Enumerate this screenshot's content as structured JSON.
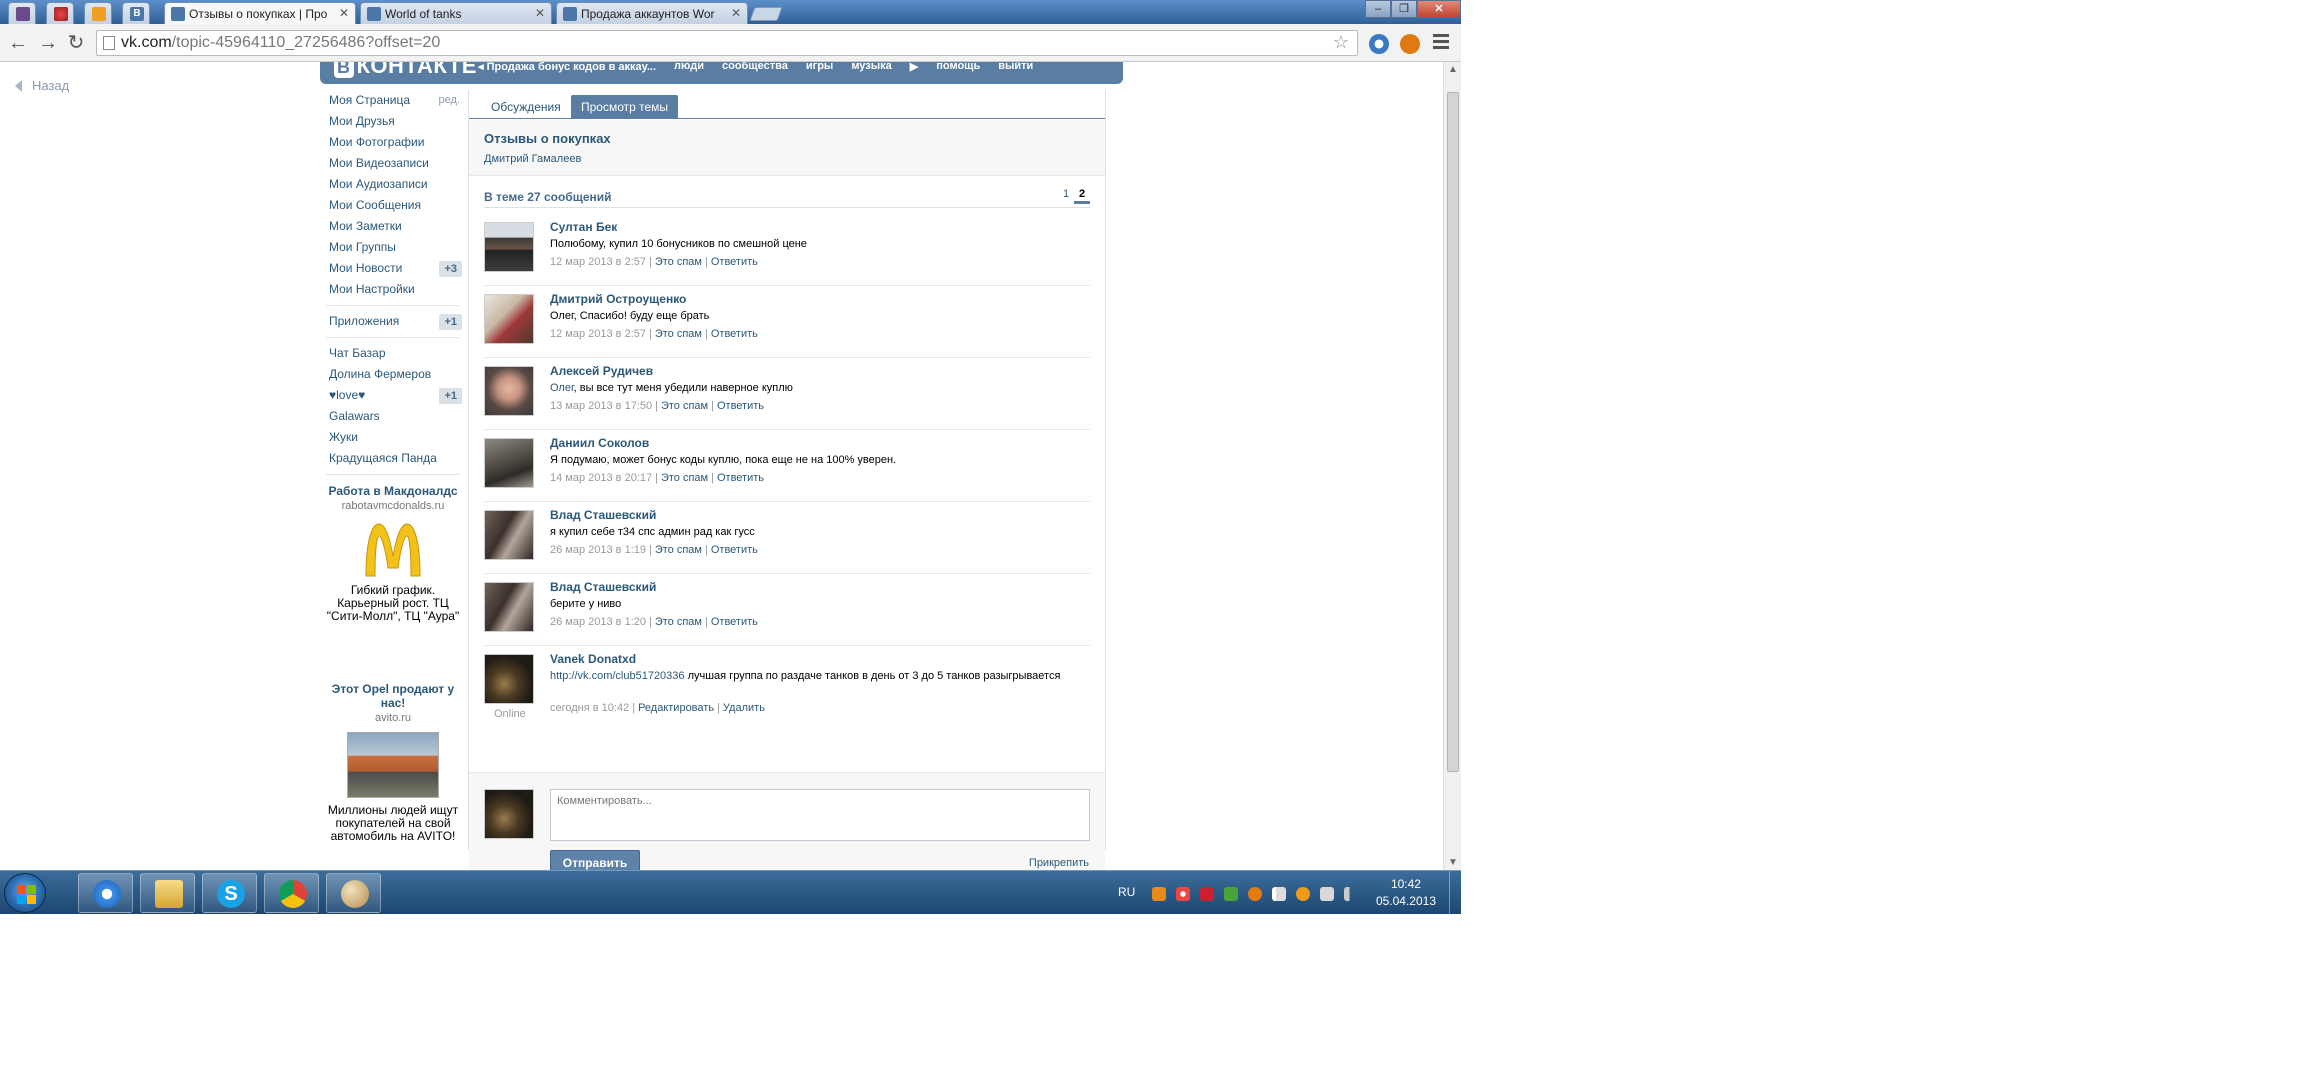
{
  "browser": {
    "tabs": [
      {
        "label": "",
        "pinned": true
      },
      {
        "label": "",
        "pinned": true
      },
      {
        "label": "",
        "pinned": true
      },
      {
        "label": "",
        "pinned": true
      },
      {
        "label": "Отзывы о покупках | Про",
        "active": true
      },
      {
        "label": "World of tanks"
      },
      {
        "label": "Продажа аккаунтов Wor"
      }
    ],
    "url_host": "vk.com",
    "url_path": "/topic-45964110_27256486?offset=20"
  },
  "page": {
    "back_label": "Назад",
    "header": {
      "logo": "ВКонтакте",
      "logo_b": "В",
      "logo_rest": "КОНТАКТЕ",
      "nav": [
        "Продажа бонус кодов в аккау...",
        "люди",
        "сообщества",
        "игры",
        "музыка",
        "помощь",
        "выйти"
      ]
    },
    "left_menu": {
      "edit_label": "ред.",
      "items": [
        {
          "label": "Моя Страница"
        },
        {
          "label": "Мои Друзья"
        },
        {
          "label": "Мои Фотографии"
        },
        {
          "label": "Мои Видеозаписи"
        },
        {
          "label": "Мои Аудиозаписи"
        },
        {
          "label": "Мои Сообщения"
        },
        {
          "label": "Мои Заметки"
        },
        {
          "label": "Мои Группы"
        },
        {
          "label": "Мои Новости",
          "badge": "+3"
        },
        {
          "label": "Мои Настройки"
        }
      ],
      "apps_label": "Приложения",
      "apps_badge": "+1",
      "apps": [
        {
          "label": "Чат Базар"
        },
        {
          "label": "Долина Фермеров"
        },
        {
          "label": "♥love♥",
          "badge": "+1"
        },
        {
          "label": "Galawars"
        },
        {
          "label": "Жуки"
        },
        {
          "label": "Крадущаяся Панда"
        }
      ]
    },
    "ads": [
      {
        "title": "Работа в Макдоналдс",
        "domain": "rabotavmcdonalds.ru",
        "text": "Гибкий график. Карьерный рост. ТЦ \"Сити-Молл\", ТЦ \"Аура\""
      },
      {
        "title": "Этот Opel продают у нас!",
        "domain": "avito.ru",
        "text": "Миллионы людей ищут покупателей на свой автомобиль на AVITO!"
      }
    ],
    "tabs": {
      "discussions": "Обсуждения",
      "view_topic": "Просмотр темы"
    },
    "topic": {
      "title": "Отзывы о покупках",
      "author": "Дмитрий Гамалеев",
      "count_label": "В теме 27 сообщений",
      "pages": [
        "1",
        "2"
      ]
    },
    "posts": [
      {
        "author": "Султан Бек",
        "text": "Полюбому, купил 10 бонусников по смешной цене",
        "date": "12 мар 2013 в 2:57",
        "spam": "Это спам",
        "reply": "Ответить"
      },
      {
        "author": "Дмитрий Остроущенко",
        "text": "Олег, Спасибо! буду еще брать",
        "date": "12 мар 2013 в 2:57",
        "spam": "Это спам",
        "reply": "Ответить"
      },
      {
        "author": "Алексей Рудичев",
        "text_link": "Олег",
        "text": ", вы все тут меня убедили наверное куплю",
        "date": "13 мар 2013 в 17:50",
        "spam": "Это спам",
        "reply": "Ответить"
      },
      {
        "author": "Даниил Соколов",
        "text": "Я подумаю, может бонус коды куплю, пока еще не на 100% уверен.",
        "date": "14 мар 2013 в 20:17",
        "spam": "Это спам",
        "reply": "Ответить"
      },
      {
        "author": "Влад Сташевский",
        "text": "я купил себе т34 спс админ рад как гусс",
        "date": "26 мар 2013 в 1:19",
        "spam": "Это спам",
        "reply": "Ответить"
      },
      {
        "author": "Влад Сташевский",
        "text": "берите у ниво",
        "date": "26 мар 2013 в 1:20",
        "spam": "Это спам",
        "reply": "Ответить"
      },
      {
        "author": "Vanek Donatxd",
        "text_link": "http://vk.com/club51720336",
        "text": " лучшая группа по раздаче танков в день от 3 до 5 танков разыгрывается",
        "date": "сегодня в 10:42",
        "edit": "Редактировать",
        "delete": "Удалить",
        "status": "Online"
      }
    ],
    "comment": {
      "placeholder": "Комментировать...",
      "send": "Отправить",
      "attach": "Прикрепить"
    }
  },
  "taskbar": {
    "lang": "RU",
    "time": "10:42",
    "date": "05.04.2013"
  }
}
